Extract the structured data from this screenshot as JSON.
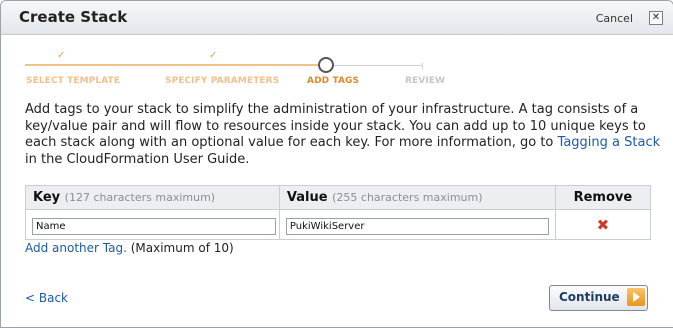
{
  "dialog": {
    "title": "Create Stack",
    "cancel_label": "Cancel",
    "close_glyph": "✕"
  },
  "wizard": {
    "check_glyph": "✓",
    "steps": [
      {
        "label": "SELECT TEMPLATE",
        "state": "done"
      },
      {
        "label": "SPECIFY PARAMETERS",
        "state": "done"
      },
      {
        "label": "ADD TAGS",
        "state": "current"
      },
      {
        "label": "REVIEW",
        "state": "future"
      }
    ]
  },
  "intro": {
    "text_before_link": "Add tags to your stack to simplify the administration of your infrastructure. A tag consists of a key/value pair and will flow to resources inside your stack. You can add up to 10 unique keys to each stack along with an optional value for each key. For more information, go to ",
    "link_text": "Tagging a Stack",
    "text_after_link": " in the CloudFormation User Guide."
  },
  "table": {
    "key_header": "Key",
    "key_hint": "(127 characters maximum)",
    "value_header": "Value",
    "value_hint": "(255 characters maximum)",
    "remove_header": "Remove",
    "rows": [
      {
        "key": "Name",
        "value": "PukiWikiServer"
      }
    ],
    "remove_glyph": "✖"
  },
  "add_tag": {
    "link": "Add another Tag.",
    "note": " (Maximum of 10)"
  },
  "footer": {
    "back_label": "< Back",
    "continue_label": "Continue"
  },
  "colors": {
    "accent": "#e08a2c",
    "link": "#1b5aa7",
    "remove": "#d23a28"
  }
}
